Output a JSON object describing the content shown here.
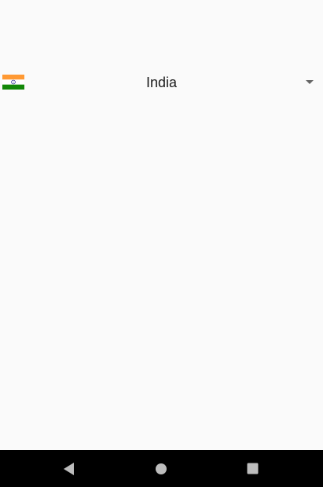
{
  "country_selector": {
    "selected_country": "India",
    "flag_icon": "india-flag-icon",
    "arrow_icon": "dropdown-arrow-icon",
    "colors": {
      "saffron": "#FF9933",
      "white": "#FFFFFF",
      "green": "#138808",
      "chakra": "#000080"
    }
  },
  "navigation_bar": {
    "back_icon": "back-triangle-icon",
    "home_icon": "home-circle-icon",
    "recents_icon": "recents-square-icon",
    "icon_color": "#BDBDBD"
  }
}
